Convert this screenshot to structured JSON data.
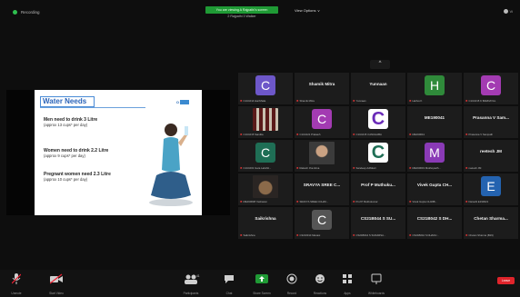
{
  "topbar": {
    "recording_label": "Recording",
    "banner_text": "You are viewing A Rajpathi's screen",
    "banner_subtext": "2 Rajpathi 3 Walker",
    "view_options": "View Options",
    "view_options_caret": "v",
    "top_right_label": "Vi"
  },
  "slide": {
    "title": "Water Needs",
    "logo_text": "O",
    "facts": [
      {
        "heading": "Men need to drink 3 Litre",
        "sub": "(approx 13 cups* per day)"
      },
      {
        "heading": "Women need to drink 2.2 Litre",
        "sub": "(approx 9 cups* per day)"
      },
      {
        "heading": "Pregnant women need 2.3 Litre",
        "sub": "(approx 10 cups* per day)"
      }
    ]
  },
  "grid_toggle": "^",
  "participants": [
    {
      "kind": "avatar",
      "letter": "C",
      "color": "#6d57c9",
      "caption": "C1U1014 HarrMaila"
    },
    {
      "kind": "name",
      "name": "Shamik Mitra",
      "caption": "Shamik Mitra"
    },
    {
      "kind": "name",
      "name": "Yunnaan",
      "caption": "Yunnaan"
    },
    {
      "kind": "avatar",
      "letter": "H",
      "color": "#2f8a3a",
      "caption": "Harfus K"
    },
    {
      "kind": "avatar",
      "letter": "C",
      "color": "#a33bb2",
      "caption": "C1U1015 K BARDAYAL"
    },
    {
      "kind": "photo",
      "photo": "flag",
      "caption": "C1U1015 Sandita"
    },
    {
      "kind": "avatar",
      "letter": "C",
      "color": "#a33bb2",
      "caption": "C1U1021 Prakash"
    },
    {
      "kind": "ring",
      "letter": "C",
      "color": "#6a2bb8",
      "caption": "C1U1015 3 ANUHABA"
    },
    {
      "kind": "name",
      "name": "ME190041",
      "caption": "ME190041"
    },
    {
      "kind": "name",
      "name": "Prasanna V Sam...",
      "caption": "Prasanna V Sampath"
    },
    {
      "kind": "avatar",
      "letter": "C",
      "color": "#1f6e55",
      "caption": "C1U1001 Gara Lakshit..."
    },
    {
      "kind": "photo",
      "photo": "face",
      "caption": "Rakesh Jha Alma"
    },
    {
      "kind": "ring",
      "letter": "C",
      "color": "#1f6e55",
      "caption": "Sandeep Adhikari"
    },
    {
      "kind": "avatar",
      "letter": "M",
      "color": "#8a3ab6",
      "caption": "ME190019 Mukhopadh..."
    },
    {
      "kind": "name",
      "name": "reetesh JM",
      "caption": "reetesh JM"
    },
    {
      "kind": "photo",
      "photo": "book",
      "caption": "ME190038 Yashaswi"
    },
    {
      "kind": "name",
      "name": "SRAVYA SREE C...",
      "caption": "SRAVYA SREE CCHAV..."
    },
    {
      "kind": "name",
      "name": "Prof P Muthuku...",
      "caption": "Prof P Muthukumar"
    },
    {
      "kind": "name",
      "name": "Vivek Gupta CH...",
      "caption": "Vivek Gupta CH19B..."
    },
    {
      "kind": "avatar",
      "letter": "E",
      "color": "#2463b0",
      "caption": "Darashi E190021"
    },
    {
      "kind": "name",
      "name": "Saikrishna",
      "caption": "Saikrishna"
    },
    {
      "kind": "avatar",
      "letter": "C",
      "color": "#555555",
      "caption": "C3210014 Manasi"
    },
    {
      "kind": "name",
      "name": "CS21B044 S SU...",
      "caption": "CS21B044 S SUDARSA..."
    },
    {
      "kind": "name",
      "name": "CS21B042 S DH...",
      "caption": "CS21B042 S DHANU..."
    },
    {
      "kind": "name",
      "name": "Chetan Sharma...",
      "caption": "Chetan Sharma (B19)"
    }
  ],
  "toolbar": {
    "buttons": [
      {
        "name": "unmute",
        "label": "Unmute",
        "icon": "microphone-icon"
      },
      {
        "name": "start-video",
        "label": "Start Video",
        "icon": "video-camera-icon"
      },
      {
        "name": "participants",
        "label": "Participants",
        "icon": "participants-icon"
      },
      {
        "name": "chat",
        "label": "Chat",
        "icon": "chat-icon"
      },
      {
        "name": "share-screen",
        "label": "Share Screen",
        "icon": "share-screen-icon"
      },
      {
        "name": "record",
        "label": "Record",
        "icon": "record-icon"
      },
      {
        "name": "reactions",
        "label": "Reactions",
        "icon": "reactions-icon"
      },
      {
        "name": "apps",
        "label": "Apps",
        "icon": "apps-icon"
      },
      {
        "name": "whiteboards",
        "label": "Whiteboards",
        "icon": "whiteboard-icon"
      }
    ],
    "participant_count": "41",
    "end_label": "Leave"
  },
  "colors": {
    "share_green": "#1f9a35",
    "leave_red": "#e0242b",
    "slide_blue": "#2a63b8"
  }
}
